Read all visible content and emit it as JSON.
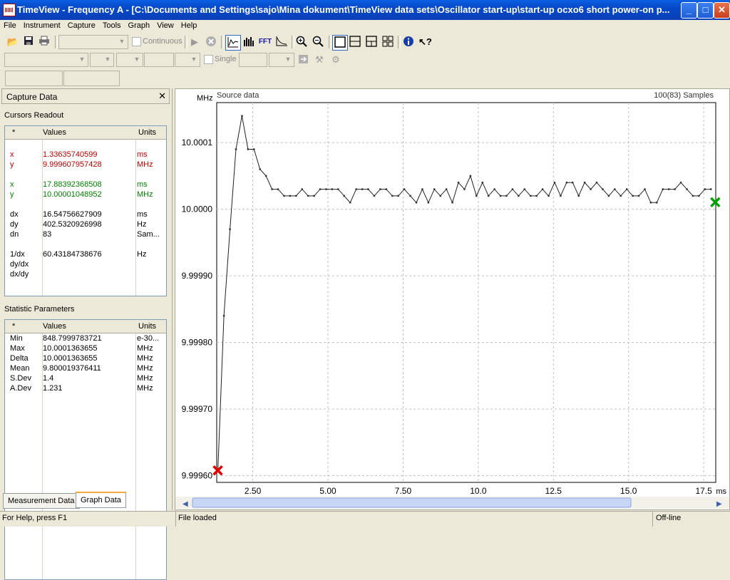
{
  "window": {
    "title": "TimeView - Frequency A - [C:\\Documents and Settings\\sajo\\Mina dokument\\TimeView data sets\\Oscillator start-up\\start-up ocxo6 short power-on p...",
    "minimize": "_",
    "maximize": "□",
    "close": "✕"
  },
  "menu": [
    "File",
    "Instrument",
    "Capture",
    "Tools",
    "Graph",
    "View",
    "Help"
  ],
  "toolbar": {
    "continuous_label": "Continuous",
    "single_label": "Single",
    "fft_label": "FFT"
  },
  "panel": {
    "title": "Capture Data",
    "close": "✕",
    "cursors_title": "Cursors Readout",
    "headers": [
      "*",
      "Values",
      "Units"
    ],
    "cursors": [
      {
        "k": "x",
        "v": "1.33635740599",
        "u": "ms",
        "color": "red"
      },
      {
        "k": "y",
        "v": "9.999607957428",
        "u": "MHz",
        "color": "red"
      },
      {
        "k": "",
        "v": "",
        "u": "",
        "color": ""
      },
      {
        "k": "x",
        "v": "17.88392368508",
        "u": "ms",
        "color": "green"
      },
      {
        "k": "y",
        "v": "10.00001048952",
        "u": "MHz",
        "color": "green"
      },
      {
        "k": "",
        "v": "",
        "u": "",
        "color": ""
      },
      {
        "k": "dx",
        "v": "16.54756627909",
        "u": "ms",
        "color": ""
      },
      {
        "k": "dy",
        "v": "402.5320926998",
        "u": "Hz",
        "color": ""
      },
      {
        "k": "dn",
        "v": "83",
        "u": "Sam...",
        "color": ""
      },
      {
        "k": "",
        "v": "",
        "u": "",
        "color": ""
      },
      {
        "k": "1/dx",
        "v": "60.43184738676",
        "u": "Hz",
        "color": ""
      },
      {
        "k": "dy/dx",
        "v": "",
        "u": "",
        "color": ""
      },
      {
        "k": "dx/dy",
        "v": "",
        "u": "",
        "color": ""
      }
    ],
    "stats_title": "Statistic Parameters",
    "stats": [
      {
        "k": "Min",
        "v": "848.7999783721",
        "u": "e-30..."
      },
      {
        "k": "Max",
        "v": "10.0001363655",
        "u": "MHz"
      },
      {
        "k": "Delta",
        "v": "10.0001363655",
        "u": "MHz"
      },
      {
        "k": "Mean",
        "v": "9.800019376411",
        "u": "MHz"
      },
      {
        "k": "S.Dev",
        "v": "1.4",
        "u": "MHz"
      },
      {
        "k": "A.Dev",
        "v": "1.231",
        "u": "MHz"
      }
    ],
    "tabs": [
      "Measurement Data",
      "Graph Data"
    ]
  },
  "graph": {
    "ylabel_unit": "MHz",
    "source": "Source data",
    "samples": "100(83) Samples",
    "xunit": "ms"
  },
  "chart_data": {
    "type": "line",
    "title": "",
    "subtitle": "Source data",
    "xlabel": "ms",
    "ylabel": "MHz",
    "xlim": [
      1.3,
      17.9
    ],
    "ylim": [
      9.99959,
      10.00016
    ],
    "xticks": [
      2.5,
      5.0,
      7.5,
      10.0,
      12.5,
      15.0,
      17.5
    ],
    "xtick_labels": [
      "2.50",
      "5.00",
      "7.50",
      "10.0",
      "12.5",
      "15.0",
      "17.5"
    ],
    "yticks": [
      9.9996,
      9.9997,
      9.9998,
      9.9999,
      10.0,
      10.0001
    ],
    "ytick_labels": [
      "9.99960",
      "9.99970",
      "9.99980",
      "9.99990",
      "10.0000",
      "10.0001"
    ],
    "grid": true,
    "x": [
      1.34,
      1.54,
      1.74,
      1.94,
      2.14,
      2.34,
      2.54,
      2.74,
      2.94,
      3.14,
      3.34,
      3.54,
      3.74,
      3.94,
      4.14,
      4.34,
      4.54,
      4.74,
      4.94,
      5.14,
      5.34,
      5.54,
      5.74,
      5.94,
      6.14,
      6.34,
      6.54,
      6.74,
      6.94,
      7.14,
      7.34,
      7.54,
      7.74,
      7.94,
      8.14,
      8.34,
      8.54,
      8.74,
      8.94,
      9.14,
      9.34,
      9.54,
      9.74,
      9.94,
      10.14,
      10.34,
      10.54,
      10.74,
      10.94,
      11.14,
      11.34,
      11.54,
      11.74,
      11.94,
      12.14,
      12.34,
      12.54,
      12.74,
      12.94,
      13.14,
      13.34,
      13.54,
      13.74,
      13.94,
      14.14,
      14.34,
      14.54,
      14.74,
      14.94,
      15.14,
      15.34,
      15.54,
      15.74,
      15.94,
      16.14,
      16.34,
      16.54,
      16.74,
      16.94,
      17.14,
      17.34,
      17.54,
      17.74
    ],
    "y": [
      9.99961,
      9.99984,
      9.99997,
      10.00009,
      10.00014,
      10.00009,
      10.00009,
      10.00006,
      10.00005,
      10.00003,
      10.00003,
      10.00002,
      10.00002,
      10.00002,
      10.00003,
      10.00002,
      10.00002,
      10.00003,
      10.00003,
      10.00003,
      10.00003,
      10.00002,
      10.00001,
      10.00003,
      10.00003,
      10.00003,
      10.00002,
      10.00003,
      10.00003,
      10.00002,
      10.00002,
      10.00003,
      10.00002,
      10.00001,
      10.00003,
      10.00001,
      10.00003,
      10.00002,
      10.00003,
      10.00001,
      10.00004,
      10.00003,
      10.00005,
      10.00002,
      10.00004,
      10.00002,
      10.00003,
      10.00002,
      10.00002,
      10.00003,
      10.00002,
      10.00003,
      10.00002,
      10.00002,
      10.00003,
      10.00002,
      10.00004,
      10.00002,
      10.00004,
      10.00004,
      10.00002,
      10.00004,
      10.00003,
      10.00004,
      10.00003,
      10.00002,
      10.00003,
      10.00002,
      10.00003,
      10.00002,
      10.00002,
      10.00003,
      10.00001,
      10.00001,
      10.00003,
      10.00003,
      10.00003,
      10.00004,
      10.00003,
      10.00002,
      10.00002,
      10.00003,
      10.00003
    ],
    "cursors": [
      {
        "x": 1.33635740599,
        "y": 9.999607957428,
        "color": "#e00000"
      },
      {
        "x": 17.88392368508,
        "y": 10.00001048952,
        "color": "#00a000"
      }
    ]
  },
  "status": {
    "help": "For Help, press F1",
    "file": "File loaded",
    "mode": "Off-line"
  }
}
